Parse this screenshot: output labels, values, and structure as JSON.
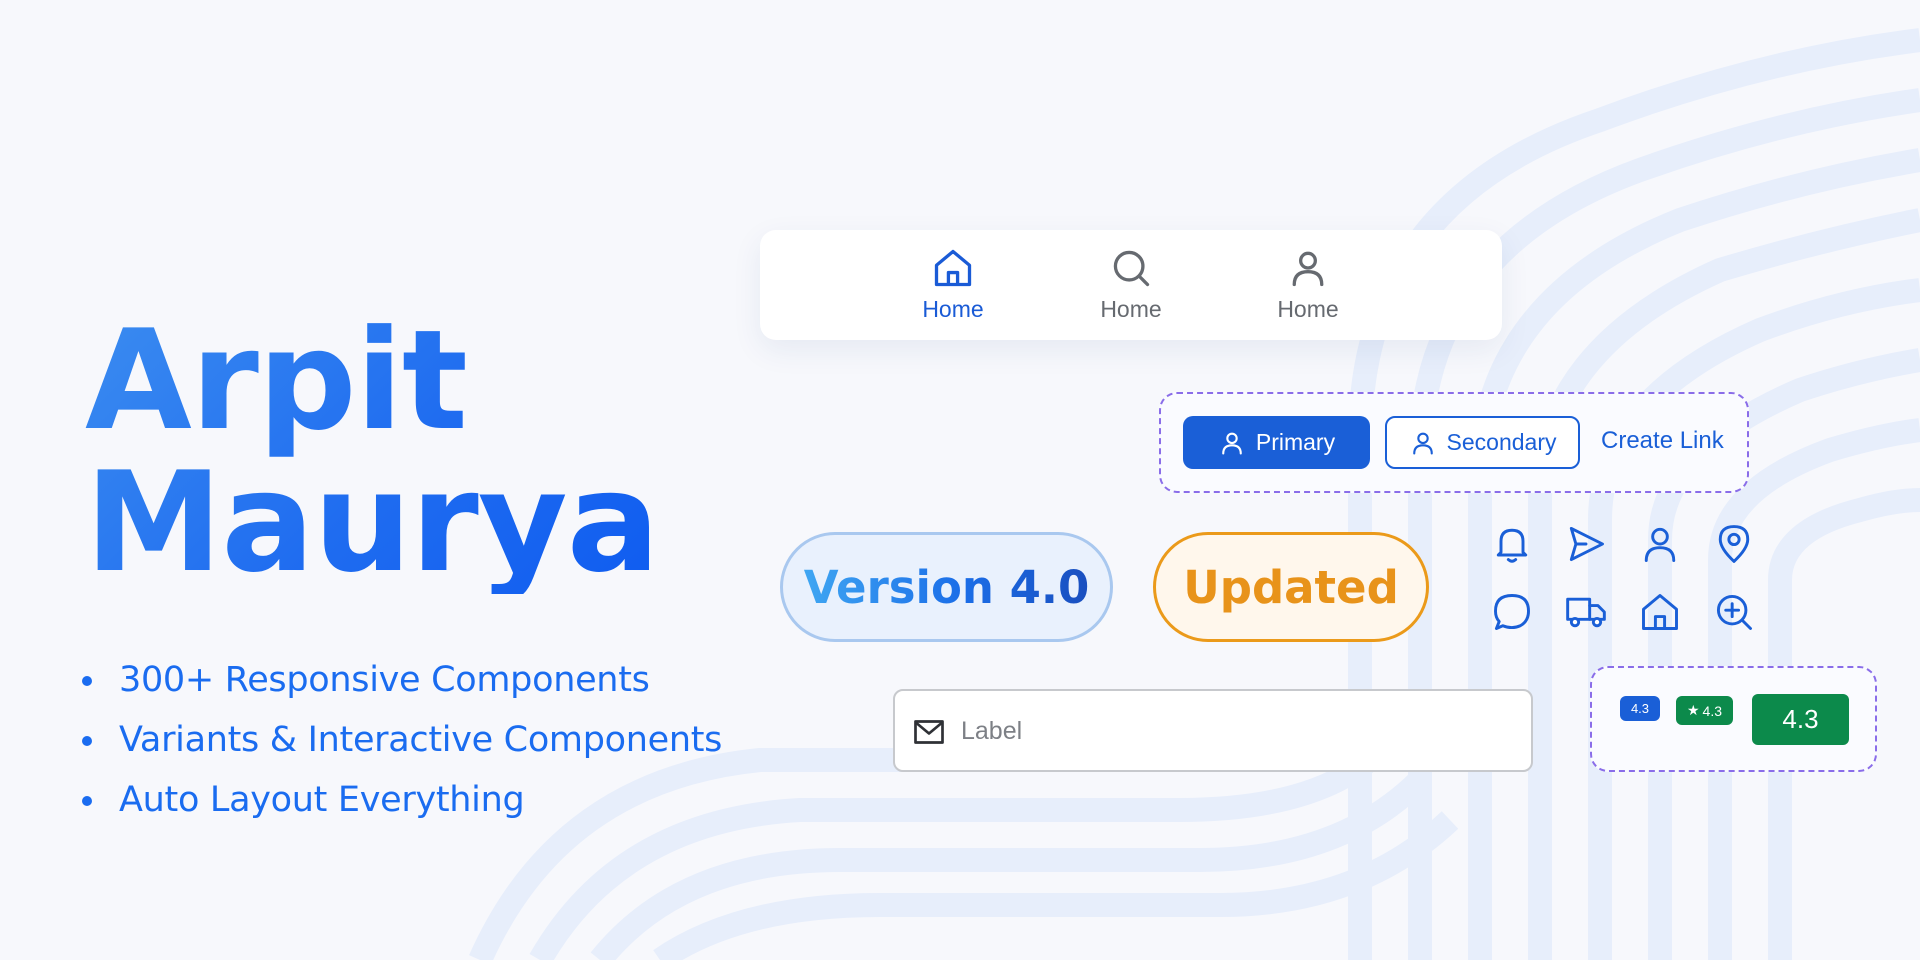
{
  "hero": {
    "title_line1": "Arpit",
    "title_line2": "Maurya",
    "features": [
      "300+ Responsive Components",
      "Variants & Interactive Components",
      "Auto Layout Everything"
    ]
  },
  "nav_bar": {
    "items": [
      {
        "label": "Home",
        "icon": "home-icon",
        "state": "active"
      },
      {
        "label": "Home",
        "icon": "search-icon",
        "state": "inactive"
      },
      {
        "label": "Home",
        "icon": "user-icon",
        "state": "inactive"
      }
    ]
  },
  "buttons": {
    "primary_label": "Primary",
    "secondary_label": "Secondary",
    "link_label": "Create Link"
  },
  "badges": {
    "version_label": "Version 4.0",
    "updated_label": "Updated"
  },
  "icons": [
    "bell-icon",
    "send-icon",
    "user-icon",
    "location-pin-icon",
    "chat-bubble-icon",
    "truck-icon",
    "home-icon",
    "zoom-in-icon"
  ],
  "input": {
    "placeholder": "Label",
    "value": ""
  },
  "ratings": {
    "small": "4.3",
    "medium": "4.3",
    "large": "4.3"
  },
  "colors": {
    "brand_blue": "#1a5fd7",
    "accent_orange": "#e8931a",
    "rating_green": "#0c8a4b",
    "dashed_purple": "#8a6de9",
    "background": "#f7f8fc"
  }
}
